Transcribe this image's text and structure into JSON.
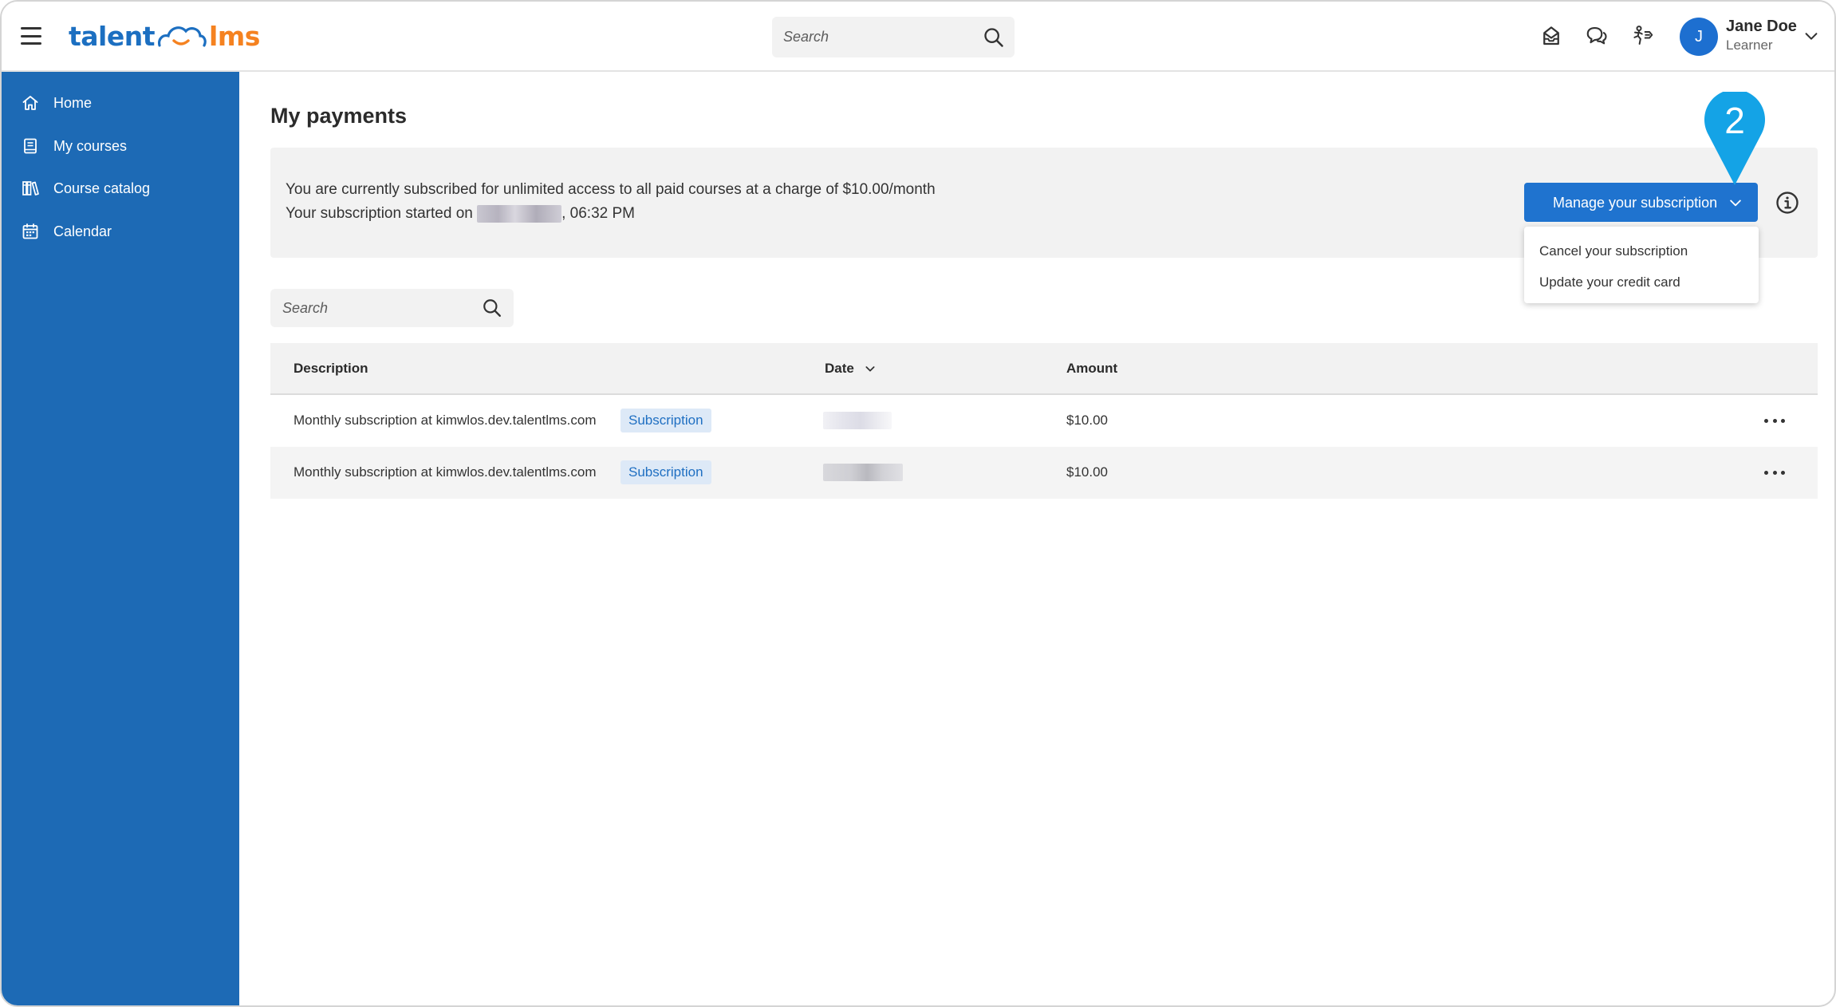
{
  "topbar": {
    "logo": {
      "part1": "talent",
      "part2": "lms"
    },
    "search": {
      "placeholder": "Search"
    },
    "user": {
      "initial": "J",
      "name": "Jane Doe",
      "role": "Learner"
    }
  },
  "sidebar": {
    "items": [
      {
        "label": "Home",
        "icon": "home-icon"
      },
      {
        "label": "My courses",
        "icon": "book-icon"
      },
      {
        "label": "Course catalog",
        "icon": "catalog-icon"
      },
      {
        "label": "Calendar",
        "icon": "calendar-icon"
      }
    ]
  },
  "main": {
    "title": "My payments",
    "subscription": {
      "line1": "You are currently subscribed for unlimited access to all paid courses at a charge of $10.00/month",
      "line2_prefix": "Your subscription started on ",
      "line2_suffix": ", 06:32 PM"
    },
    "manage_button": "Manage your subscription",
    "dropdown": {
      "items": [
        "Cancel your subscription",
        "Update your credit card"
      ]
    },
    "marker_number": "2",
    "list_search": {
      "placeholder": "Search"
    },
    "table": {
      "headers": {
        "description": "Description",
        "date": "Date",
        "amount": "Amount"
      },
      "rows": [
        {
          "description": "Monthly subscription at kimwlos.dev.talentlms.com",
          "badge": "Subscription",
          "amount": "$10.00"
        },
        {
          "description": "Monthly subscription at kimwlos.dev.talentlms.com",
          "badge": "Subscription",
          "amount": "$10.00"
        }
      ]
    }
  },
  "colors": {
    "sidebar": "#1d6ab5",
    "primary_button": "#1f73cf",
    "marker": "#14a3e6",
    "logo_blue": "#1c6fc1",
    "logo_orange": "#f58220"
  }
}
